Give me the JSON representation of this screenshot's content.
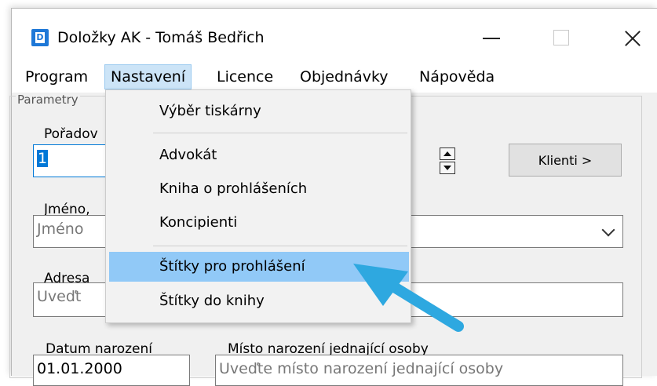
{
  "window": {
    "app_icon_letter": "D",
    "title": "Doložky AK - Tomáš Bedřich"
  },
  "menubar": {
    "items": [
      {
        "label": "Program"
      },
      {
        "label": "Nastavení"
      },
      {
        "label": "Licence"
      },
      {
        "label": "Objednávky"
      },
      {
        "label": "Nápověda"
      }
    ]
  },
  "dropdown": {
    "items": [
      {
        "label": "Výběr tiskárny"
      },
      {
        "label": "Advokát"
      },
      {
        "label": "Kniha o prohlášeních"
      },
      {
        "label": "Koncipienti"
      },
      {
        "label": "Štítky pro prohlášení"
      },
      {
        "label": "Štítky do knihy"
      }
    ]
  },
  "form": {
    "group_legend": "Parametry",
    "order_label": "Pořadov",
    "order_value": "1",
    "klienti_button": "Klienti >",
    "name_label": "Jméno, ",
    "name_placeholder": "Jméno",
    "address_label": "Adresa ",
    "address_placeholder": "Uveďt",
    "birthdate_label": "Datum narození",
    "birthdate_value": "01.01.2000",
    "birthplace_label": "Místo narození jednající osoby",
    "birthplace_placeholder": "Uveďte místo narození jednající osoby"
  },
  "colors": {
    "menu_active_bg": "#cce4f7",
    "dropdown_highlight": "#91c9f7",
    "annotation_arrow": "#2ea8e0"
  }
}
